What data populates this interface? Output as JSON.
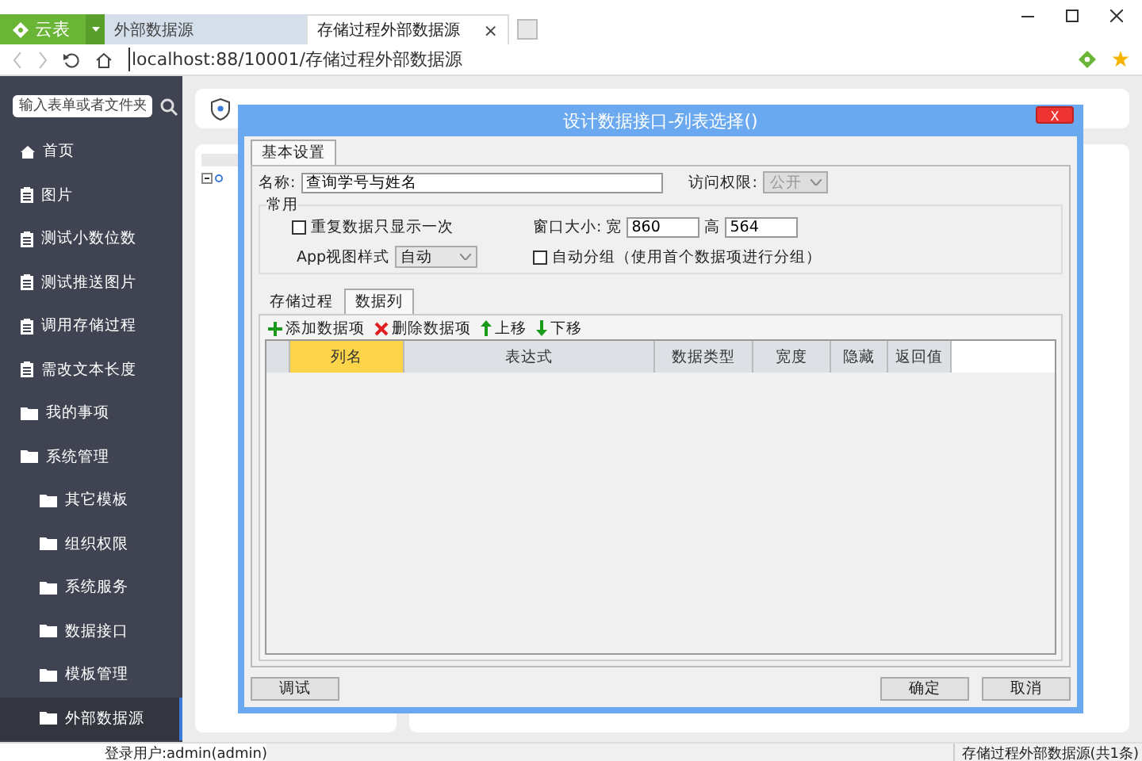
{
  "browser": {
    "brand": "云表",
    "tabs": [
      {
        "label": "外部数据源",
        "selected": false
      },
      {
        "label": "存储过程外部数据源",
        "selected": true
      }
    ],
    "close_tab": "×",
    "address": "localhost:88/10001/存储过程外部数据源"
  },
  "sidebar": {
    "search_placeholder": "输入表单或者文件夹",
    "items": [
      {
        "label": "首页",
        "kind": "home",
        "selected": false
      },
      {
        "label": "图片",
        "kind": "form",
        "selected": false
      },
      {
        "label": "测试小数位数",
        "kind": "form",
        "selected": false
      },
      {
        "label": "测试推送图片",
        "kind": "form",
        "selected": false
      },
      {
        "label": "调用存储过程",
        "kind": "form",
        "selected": false
      },
      {
        "label": "需改文本长度",
        "kind": "form",
        "selected": false
      },
      {
        "label": "我的事项",
        "kind": "folder",
        "selected": false
      },
      {
        "label": "系统管理",
        "kind": "folder",
        "selected": false,
        "children": [
          {
            "label": "其它模板",
            "kind": "folder",
            "selected": false
          },
          {
            "label": "组织权限",
            "kind": "folder",
            "selected": false
          },
          {
            "label": "系统服务",
            "kind": "folder",
            "selected": false
          },
          {
            "label": "数据接口",
            "kind": "folder",
            "selected": false
          },
          {
            "label": "模板管理",
            "kind": "folder",
            "selected": false
          },
          {
            "label": "外部数据源",
            "kind": "folder",
            "selected": true
          }
        ]
      }
    ]
  },
  "dialog": {
    "title": "设计数据接口-列表选择()",
    "close": "X",
    "tabs": [
      {
        "label": "基本设置",
        "selected": true
      }
    ],
    "name_label": "名称:",
    "name_value": "查询学号与姓名",
    "access_label": "访问权限:",
    "access_value": "公开",
    "access_disabled": true,
    "group_title": "常用",
    "repeat_once": {
      "label": "重复数据只显示一次",
      "checked": false
    },
    "size_label": "窗口大小: 宽",
    "width_value": "860",
    "height_label": "高",
    "height_value": "564",
    "app_view_label": "App视图样式",
    "app_view_value": "自动",
    "auto_group": {
      "label": "自动分组（使用首个数据项进行分组）",
      "checked": false
    },
    "inner_tabs": [
      {
        "label": "存储过程",
        "selected": false
      },
      {
        "label": "数据列",
        "selected": true
      }
    ],
    "toolbar": [
      {
        "label": "添加数据项",
        "kind": "add"
      },
      {
        "label": "删除数据项",
        "kind": "delete"
      },
      {
        "label": "上移",
        "kind": "up"
      },
      {
        "label": "下移",
        "kind": "down"
      }
    ],
    "columns": [
      {
        "label": "列名",
        "selected": true
      },
      {
        "label": "表达式",
        "selected": false
      },
      {
        "label": "数据类型",
        "selected": false
      },
      {
        "label": "宽度",
        "selected": false
      },
      {
        "label": "隐藏",
        "selected": false
      },
      {
        "label": "返回值",
        "selected": false
      }
    ],
    "buttons": [
      {
        "label": "调试",
        "kind": "left"
      },
      {
        "label": "确定",
        "kind": "right"
      },
      {
        "label": "取消",
        "kind": "right"
      }
    ]
  },
  "status_bar": {
    "user": "登录用户:admin(admin)",
    "summary": "存储过程外部数据源(共1条)"
  }
}
